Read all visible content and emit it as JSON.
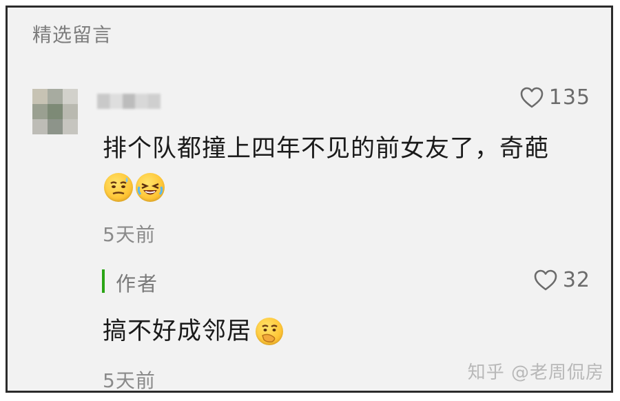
{
  "section": {
    "title": "精选留言"
  },
  "comment": {
    "like_count": "135",
    "text": "排个队都撞上四年不见的前女友了，奇葩",
    "emojis": [
      "grimace-sweat-emoji",
      "crying-laugh-emoji"
    ],
    "time": "5天前"
  },
  "reply": {
    "author_label": "作者",
    "like_count": "32",
    "text": "搞不好成邻居",
    "emoji": "thinking-hand-emoji",
    "time": "5天前"
  },
  "watermark": {
    "text": "知乎 @老周侃房"
  },
  "colors": {
    "author_accent": "#2aa515",
    "background": "#f2f2f2",
    "frame_border": "#2b2b2b"
  }
}
